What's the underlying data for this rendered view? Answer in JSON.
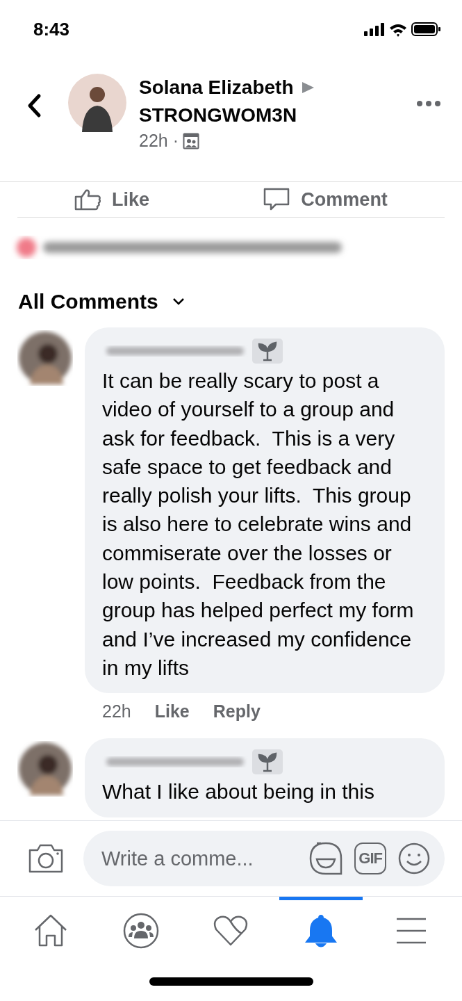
{
  "status_bar": {
    "time": "8:43"
  },
  "header": {
    "author": "Solana Elizabeth",
    "group": "STRONGWOM3N",
    "time": "22h ·"
  },
  "post_actions": [
    {
      "kind": "like",
      "label": "Like"
    },
    {
      "kind": "comment",
      "label": "Comment"
    }
  ],
  "comments_sort": {
    "label": "All Comments"
  },
  "comments": [
    {
      "text": "It can be really scary to post a video of yourself to a group and ask for feedback.  This is a very safe space to get feedback and really polish your lifts.  This group is also here to celebrate wins and commiserate over the losses or low points.  Feedback from the group has helped perfect my form and I’ve increased my confidence in my lifts",
      "time": "22h",
      "actions": [
        "Like",
        "Reply"
      ]
    },
    {
      "text": "What I like about being in this"
    }
  ],
  "composer": {
    "placeholder": "Write a comme...",
    "gif": "GIF"
  },
  "tabs": [
    {
      "kind": "home",
      "selected": false
    },
    {
      "kind": "groups",
      "selected": false
    },
    {
      "kind": "dating",
      "selected": false
    },
    {
      "kind": "notifications",
      "selected": true
    },
    {
      "kind": "menu",
      "selected": false
    }
  ]
}
